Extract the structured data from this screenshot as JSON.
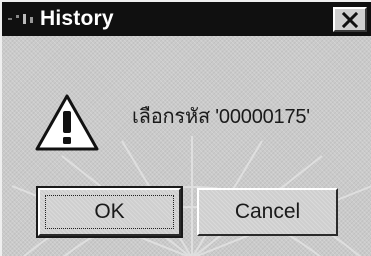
{
  "window": {
    "title": "History",
    "close_icon": "close-x-icon",
    "app_icon": "app-icon"
  },
  "dialog": {
    "icon": "warning-icon",
    "message": "เลือกรหัส '00000175'"
  },
  "buttons": {
    "ok_label": "OK",
    "cancel_label": "Cancel"
  },
  "colors": {
    "titlebar": "#101010",
    "title_text": "#ffffff",
    "dialog_bg": "#c6c6c6",
    "warning_fill": "#ffffff"
  }
}
